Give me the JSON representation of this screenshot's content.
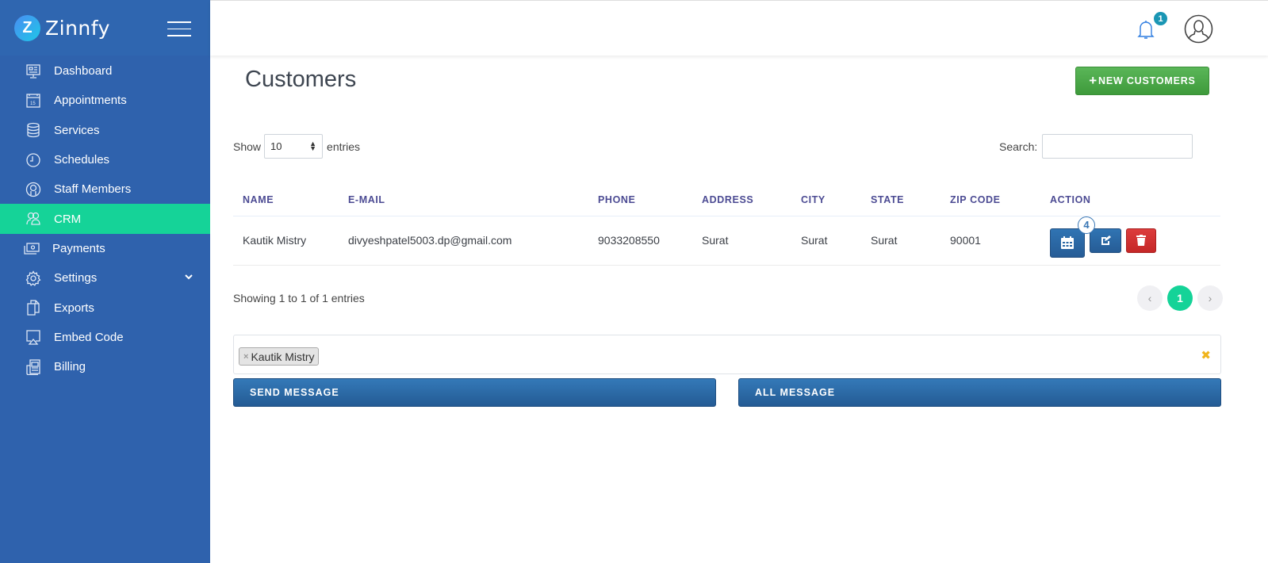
{
  "brand": {
    "logo_letter": "Z",
    "name": "Zinnfy"
  },
  "sidebar": {
    "items": [
      {
        "label": "Dashboard",
        "icon": "dashboard-icon",
        "active": false
      },
      {
        "label": "Appointments",
        "icon": "calendar-icon",
        "active": false
      },
      {
        "label": "Services",
        "icon": "database-icon",
        "active": false
      },
      {
        "label": "Schedules",
        "icon": "clock-icon",
        "active": false
      },
      {
        "label": "Staff Members",
        "icon": "user-icon",
        "active": false
      },
      {
        "label": "CRM",
        "icon": "users-icon",
        "active": true
      },
      {
        "label": "Payments",
        "icon": "money-icon",
        "active": false
      },
      {
        "label": "Settings",
        "icon": "gear-icon",
        "active": false,
        "has_submenu": true
      },
      {
        "label": "Exports",
        "icon": "files-icon",
        "active": false
      },
      {
        "label": "Embed Code",
        "icon": "monitor-icon",
        "active": false
      },
      {
        "label": "Billing",
        "icon": "billing-icon",
        "active": false
      }
    ],
    "calendar_icon_day": "15"
  },
  "topbar": {
    "notification_count": "1"
  },
  "page": {
    "title": "Customers",
    "new_button": "NEW CUSTOMERS",
    "length": {
      "show": "Show",
      "value": "10",
      "entries": "entries"
    },
    "search": {
      "label": "Search:",
      "value": "",
      "placeholder": ""
    },
    "table": {
      "columns": [
        "NAME",
        "E-MAIL",
        "PHONE",
        "ADDRESS",
        "CITY",
        "STATE",
        "ZIP CODE",
        "ACTION"
      ],
      "rows": [
        {
          "name": "Kautik Mistry",
          "email": "divyeshpatel5003.dp@gmail.com",
          "phone": "9033208550",
          "address": "Surat",
          "city": "Surat",
          "state": "Surat",
          "zip": "90001",
          "appointment_count": "4"
        }
      ]
    },
    "info": "Showing 1 to 1 of 1 entries",
    "pagination": {
      "prev": "‹",
      "current": "1",
      "next": "›"
    },
    "recipients": {
      "tags": [
        "Kautik Mistry"
      ],
      "remove_glyph": "×",
      "clear_glyph": "✖"
    },
    "send_message": "SEND MESSAGE",
    "all_message": "ALL MESSAGE"
  },
  "colors": {
    "sidebar": "#2f62ad",
    "active": "#15d398",
    "primary": "#2a67a5",
    "success": "#4caf50",
    "danger": "#d23232",
    "header_text": "#4c4b93"
  }
}
